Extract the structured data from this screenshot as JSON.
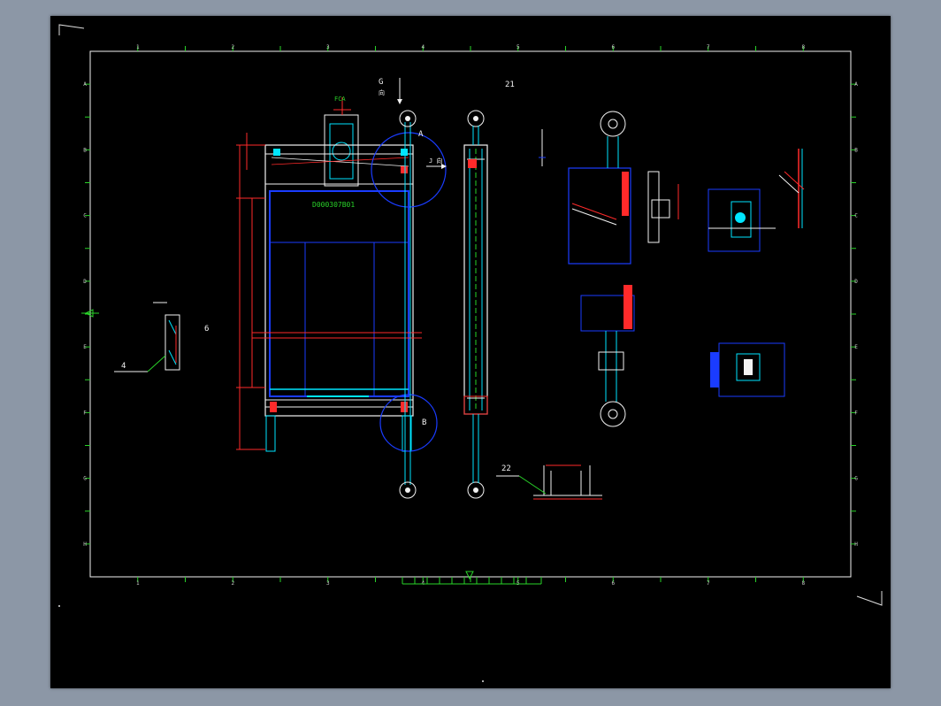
{
  "colors": {
    "background": "#000000",
    "frame": "#ffffff",
    "red": "#ff2a2a",
    "blue": "#1a3cff",
    "cyan": "#00e5ff",
    "green": "#29d329",
    "yellow": "#ffff40",
    "white": "#f2f2f2"
  },
  "grid": {
    "top_numbers": [
      "1",
      "2",
      "3",
      "4",
      "5",
      "6",
      "7",
      "8"
    ],
    "bottom_numbers": [
      "1",
      "2",
      "3",
      "4",
      "5",
      "6",
      "7",
      "8"
    ],
    "left_letters": [
      "A",
      "B",
      "C",
      "D",
      "E",
      "F",
      "G",
      "H"
    ],
    "right_letters": [
      "A",
      "B",
      "C",
      "D",
      "E",
      "F",
      "G",
      "H"
    ]
  },
  "labels": {
    "view_g": "G",
    "view_g_dir": "向",
    "view_j": "J 向",
    "callout_21": "21",
    "callout_22": "22",
    "callout_4": "4",
    "callout_6": "6",
    "detail_a": "A",
    "detail_b": "B",
    "drawing_code": "D000307B01",
    "top_mark": "FCA"
  },
  "icons": {
    "crosshair": "crosshair-icon",
    "ucs": "ucs-icon"
  }
}
